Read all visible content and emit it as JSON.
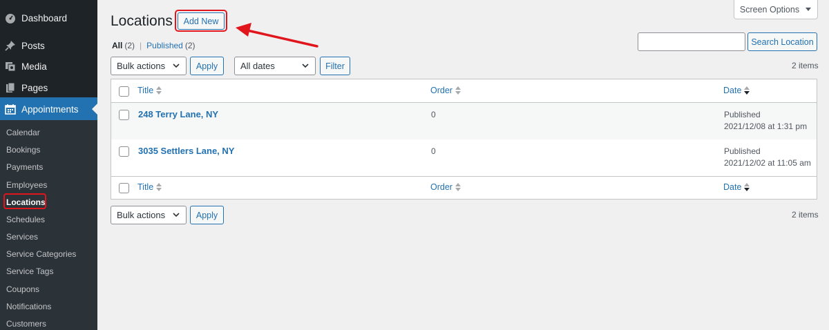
{
  "sidebar": {
    "items": [
      {
        "label": "Dashboard",
        "icon": "dashboard-icon"
      },
      {
        "label": "Posts",
        "icon": "pin-icon"
      },
      {
        "label": "Media",
        "icon": "media-icon"
      },
      {
        "label": "Pages",
        "icon": "pages-icon"
      },
      {
        "label": "Appointments",
        "icon": "calendar-icon"
      }
    ],
    "submenu": [
      "Calendar",
      "Bookings",
      "Payments",
      "Employees",
      "Locations",
      "Schedules",
      "Services",
      "Service Categories",
      "Service Tags",
      "Coupons",
      "Notifications",
      "Customers"
    ]
  },
  "header": {
    "title": "Locations",
    "add_new": "Add New",
    "screen_options": "Screen Options"
  },
  "filters": {
    "all_label": "All",
    "all_count": "(2)",
    "separator": "|",
    "published_label": "Published",
    "published_count": "(2)"
  },
  "search": {
    "value": "",
    "button": "Search Location"
  },
  "toolbar": {
    "bulk_actions": "Bulk actions",
    "apply": "Apply",
    "dates": "All dates",
    "filter": "Filter",
    "items_count": "2 items"
  },
  "table": {
    "columns": {
      "title": "Title",
      "order": "Order",
      "date": "Date"
    },
    "rows": [
      {
        "title": "248 Terry Lane, NY",
        "order": "0",
        "status": "Published",
        "date": "2021/12/08 at 1:31 pm"
      },
      {
        "title": "3035 Settlers Lane, NY",
        "order": "0",
        "status": "Published",
        "date": "2021/12/02 at 11:05 am"
      }
    ]
  },
  "bottom_toolbar": {
    "bulk_actions": "Bulk actions",
    "apply": "Apply",
    "items_count": "2 items"
  },
  "colors": {
    "sidebar_bg": "#1d2327",
    "submenu_bg": "#2c3338",
    "accent": "#2271b1",
    "annotation": "#e0161c",
    "page_bg": "#f0f0f1"
  }
}
